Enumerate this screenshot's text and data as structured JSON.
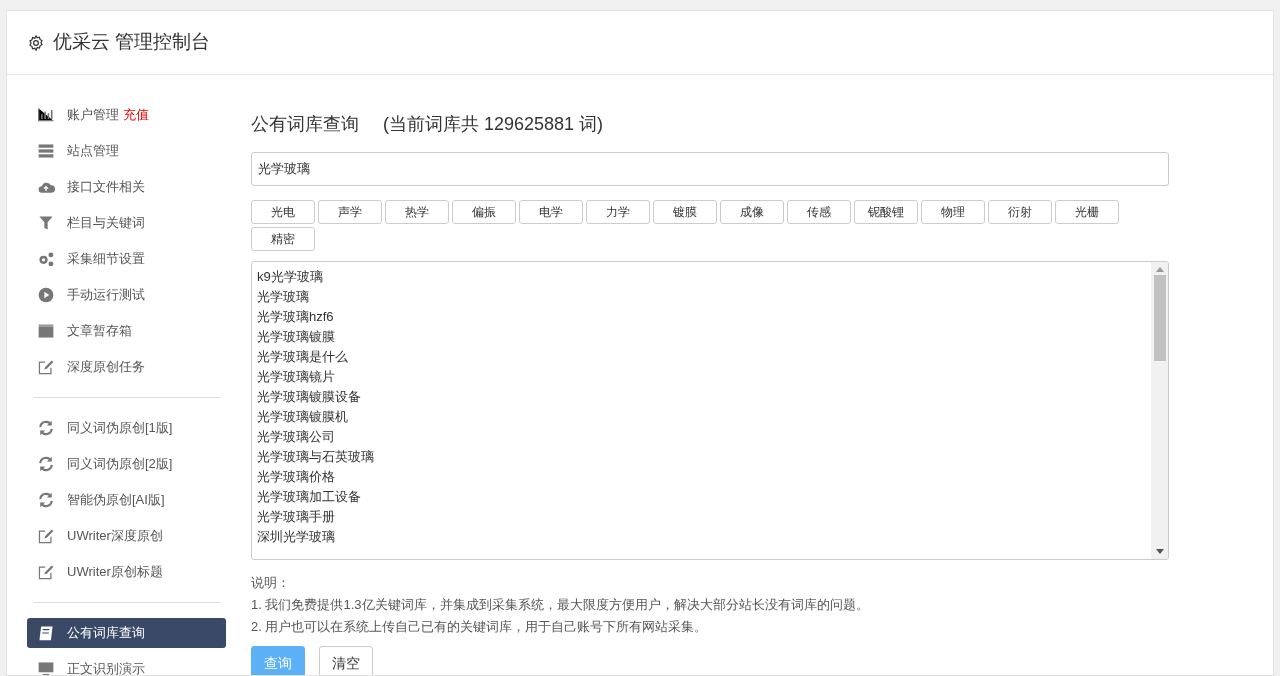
{
  "header": {
    "title": "优采云 管理控制台"
  },
  "sidebar": {
    "groups": [
      [
        {
          "label": "账户管理",
          "badge": "充值",
          "selected": false
        },
        {
          "label": "站点管理",
          "selected": false
        },
        {
          "label": "接口文件相关",
          "selected": false
        },
        {
          "label": "栏目与关键词",
          "selected": false
        },
        {
          "label": "采集细节设置",
          "selected": false
        },
        {
          "label": "手动运行测试",
          "selected": false
        },
        {
          "label": "文章暂存箱",
          "selected": false
        },
        {
          "label": "深度原创任务",
          "selected": false
        }
      ],
      [
        {
          "label": "同义词伪原创[1版]",
          "selected": false
        },
        {
          "label": "同义词伪原创[2版]",
          "selected": false
        },
        {
          "label": "智能伪原创[AI版]",
          "selected": false
        },
        {
          "label": "UWriter深度原创",
          "selected": false
        },
        {
          "label": "UWriter原创标题",
          "selected": false
        }
      ],
      [
        {
          "label": "公有词库查询",
          "selected": true
        },
        {
          "label": "正文识别演示",
          "selected": false
        }
      ]
    ]
  },
  "main": {
    "heading": "公有词库查询",
    "count_note": "(当前词库共 129625881 词)",
    "search": {
      "value": "光学玻璃"
    },
    "tags": [
      "光电",
      "声学",
      "热学",
      "偏振",
      "电学",
      "力学",
      "镀膜",
      "成像",
      "传感",
      "铌酸锂",
      "物理",
      "衍射",
      "光栅",
      "精密"
    ],
    "results": [
      "k9光学玻璃",
      "光学玻璃",
      "光学玻璃hzf6",
      "光学玻璃镀膜",
      "光学玻璃是什么",
      "光学玻璃镜片",
      "光学玻璃镀膜设备",
      "光学玻璃镀膜机",
      "光学玻璃公司",
      "光学玻璃与石英玻璃",
      "光学玻璃价格",
      "光学玻璃加工设备",
      "光学玻璃手册",
      "深圳光学玻璃"
    ],
    "notes_title": "说明：",
    "notes": [
      "1. 我们免费提供1.3亿关键词库，并集成到采集系统，最大限度方便用户，解决大部分站长没有词库的问题。",
      "2. 用户也可以在系统上传自己已有的关键词库，用于自己账号下所有网站采集。"
    ],
    "buttons": [
      {
        "kind": "primary",
        "label": "查询"
      },
      {
        "kind": "default",
        "label": "清空"
      }
    ]
  }
}
